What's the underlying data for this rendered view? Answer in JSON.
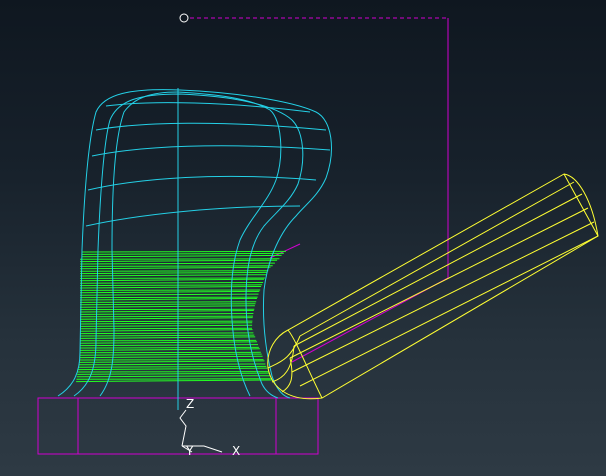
{
  "viewport": {
    "triad": {
      "z_label": "Z",
      "y_label": "Y",
      "x_label": "X"
    }
  },
  "colors": {
    "background_top": "#0f1720",
    "background_bottom": "#2e3a44",
    "part_wireframe": "#24d0e6",
    "toolpath": "#22ff22",
    "stock": "#d000d0",
    "tool": "#ffff33",
    "triad": "#ffffff"
  },
  "icons": {
    "tool_start_point": "circle-marker-icon",
    "coordinate_triad": "xyz-triad-icon"
  }
}
